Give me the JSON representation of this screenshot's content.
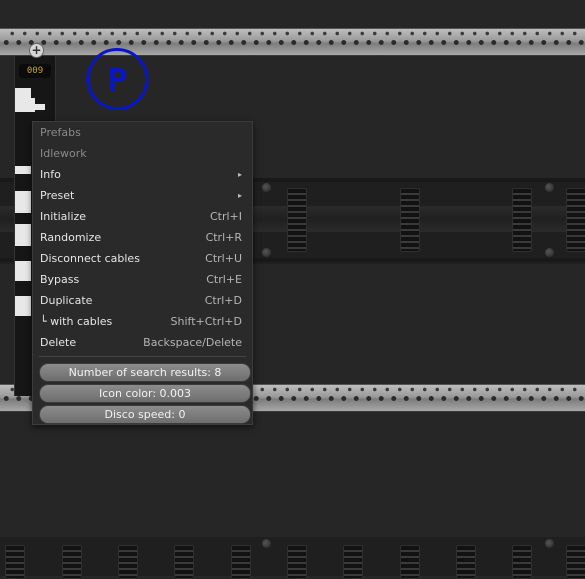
{
  "module": {
    "counter": "009",
    "logo_letter": "P"
  },
  "menu": {
    "headers": [
      "Prefabs",
      "Idlework"
    ],
    "items": [
      {
        "label": "Info",
        "submenu": true,
        "shortcut": ""
      },
      {
        "label": "Preset",
        "submenu": true,
        "shortcut": ""
      },
      {
        "label": "Initialize",
        "submenu": false,
        "shortcut": "Ctrl+I"
      },
      {
        "label": "Randomize",
        "submenu": false,
        "shortcut": "Ctrl+R"
      },
      {
        "label": "Disconnect cables",
        "submenu": false,
        "shortcut": "Ctrl+U"
      },
      {
        "label": "Bypass",
        "submenu": false,
        "shortcut": "Ctrl+E"
      },
      {
        "label": "Duplicate",
        "submenu": false,
        "shortcut": "Ctrl+D"
      },
      {
        "label": "└ with cables",
        "submenu": false,
        "shortcut": "Shift+Ctrl+D"
      },
      {
        "label": "Delete",
        "submenu": false,
        "shortcut": "Backspace/Delete"
      }
    ],
    "submenu_arrow": "▸",
    "sliders": [
      {
        "label": "Number of search results: 8",
        "value": 8
      },
      {
        "label": "Icon color: 0.003",
        "value": 0.003
      },
      {
        "label": "Disco speed: 0",
        "value": 0
      }
    ]
  },
  "icons": {
    "add_screw": "plus-icon",
    "logo": "p-logo-icon"
  },
  "colors": {
    "logo_blue": "#0a16c4",
    "counter_text": "#c9a43a",
    "menu_bg": "#2a2a2a"
  }
}
